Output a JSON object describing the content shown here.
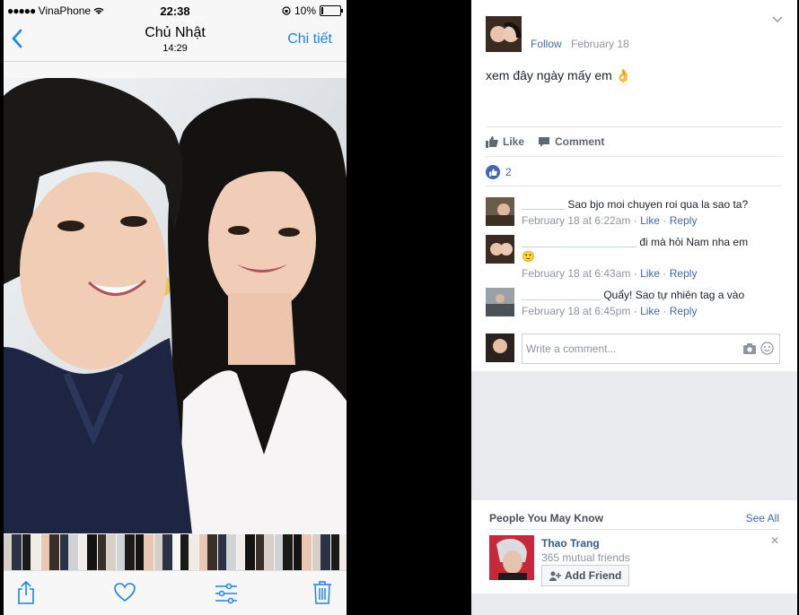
{
  "phone": {
    "status": {
      "dots": "●●●●●",
      "carrier": "VinaPhone",
      "time": "22:38",
      "battery": "10%",
      "battery_level": 0.1
    },
    "nav": {
      "title": "Chủ Nhật",
      "subtitle": "14:29",
      "detail": "Chi tiết"
    },
    "photo": {
      "subject": "selfie of two women"
    },
    "toolbar": {
      "icons": [
        "share-icon",
        "heart-icon",
        "adjust-icon",
        "trash-icon"
      ]
    }
  },
  "post": {
    "follow": "Follow",
    "date": "February 18",
    "text": "xem đây ngày mấy em",
    "emoji": "👌",
    "like_label": "Like",
    "comment_label": "Comment",
    "like_count": "2",
    "comments": [
      {
        "text": "Sao bjo moi chuyen roi qua la sao ta?",
        "time": "February 18 at 6:22am",
        "like": "Like",
        "reply": "Reply"
      },
      {
        "text": "đi mà hỏi Nam nha em",
        "emoji": "🙂",
        "time": "February 18 at 6:43am",
        "like": "Like",
        "reply": "Reply"
      },
      {
        "text": "Quẩy! Sao tự nhiên tag a vào",
        "time": "February 18 at 6:45pm",
        "like": "Like",
        "reply": "Reply"
      }
    ],
    "write_placeholder": "Write a comment..."
  },
  "pymk": {
    "heading": "People You May Know",
    "see_all": "See All",
    "person": {
      "name": "Thao Trang",
      "mutual": "365 mutual friends",
      "add_label": "Add Friend"
    },
    "close": "✕"
  },
  "colors": {
    "fb_blue": "#4267b2",
    "ios_blue": "#1a82fb"
  }
}
